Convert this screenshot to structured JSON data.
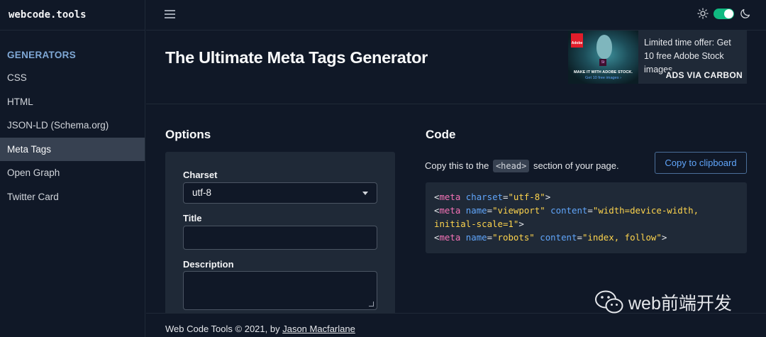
{
  "sidebar": {
    "brand": "webcode.tools",
    "group_label": "GENERATORS",
    "items": [
      {
        "label": "CSS"
      },
      {
        "label": "HTML"
      },
      {
        "label": "JSON-LD (Schema.org)"
      },
      {
        "label": "Meta Tags"
      },
      {
        "label": "Open Graph"
      },
      {
        "label": "Twitter Card"
      }
    ],
    "active_item": "Meta Tags"
  },
  "topbar": {
    "theme_toggle_on": true,
    "icons": [
      "menu-icon",
      "sun-icon",
      "moon-icon"
    ],
    "accent_color": "#10b981"
  },
  "header": {
    "title": "The Ultimate Meta Tags Generator"
  },
  "ad": {
    "image_brand": "Adobe",
    "image_badge": "St",
    "image_line1": "MAKE IT WITH ADOBE STOCK.",
    "image_line2": "Get 10 free images ›",
    "text": "Limited time offer: Get 10 free Adobe Stock images.",
    "via": "ADS VIA CARBON"
  },
  "options": {
    "title": "Options",
    "charset_label": "Charset",
    "charset_value": "utf-8",
    "title_label": "Title",
    "title_value": "",
    "description_label": "Description",
    "description_value": ""
  },
  "code": {
    "title": "Code",
    "desc_before": "Copy this to the",
    "desc_tag": "<head>",
    "desc_after": "section of your page.",
    "copy_button": "Copy to clipboard",
    "lines": [
      [
        {
          "t": "<",
          "c": "punc"
        },
        {
          "t": "meta",
          "c": "tag"
        },
        {
          "t": " charset",
          "c": "attr"
        },
        {
          "t": "=",
          "c": "punc"
        },
        {
          "t": "\"utf-8\"",
          "c": "val"
        },
        {
          "t": ">",
          "c": "punc"
        }
      ],
      [
        {
          "t": "<",
          "c": "punc"
        },
        {
          "t": "meta",
          "c": "tag"
        },
        {
          "t": " name",
          "c": "attr"
        },
        {
          "t": "=",
          "c": "punc"
        },
        {
          "t": "\"viewport\"",
          "c": "val"
        },
        {
          "t": " content",
          "c": "attr"
        },
        {
          "t": "=",
          "c": "punc"
        },
        {
          "t": "\"width=device-width,",
          "c": "val"
        }
      ],
      [
        {
          "t": "initial-scale=1\"",
          "c": "val"
        },
        {
          "t": ">",
          "c": "punc"
        }
      ],
      [
        {
          "t": "<",
          "c": "punc"
        },
        {
          "t": "meta",
          "c": "tag"
        },
        {
          "t": " name",
          "c": "attr"
        },
        {
          "t": "=",
          "c": "punc"
        },
        {
          "t": "\"robots\"",
          "c": "val"
        },
        {
          "t": " content",
          "c": "attr"
        },
        {
          "t": "=",
          "c": "punc"
        },
        {
          "t": "\"index, follow\"",
          "c": "val"
        },
        {
          "t": ">",
          "c": "punc"
        }
      ]
    ]
  },
  "footer": {
    "text": "Web Code Tools © 2021, by",
    "link": "Jason Macfarlane"
  },
  "watermark": {
    "text": "web前端开发",
    "icon": "wechat-icon"
  }
}
